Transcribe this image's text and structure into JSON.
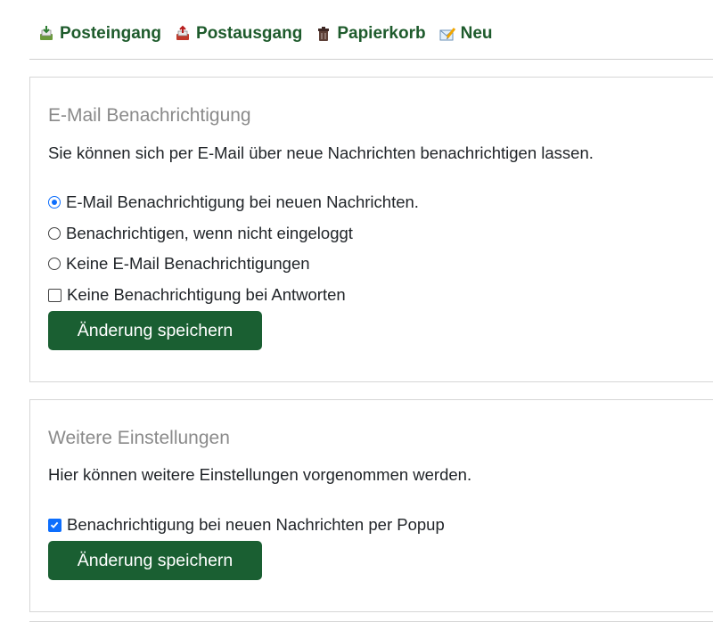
{
  "nav": {
    "items": [
      {
        "label": "Posteingang",
        "icon": "inbox-tray-icon"
      },
      {
        "label": "Postausgang",
        "icon": "outbox-tray-icon"
      },
      {
        "label": "Papierkorb",
        "icon": "trash-bin-icon"
      },
      {
        "label": "Neu",
        "icon": "compose-icon"
      }
    ]
  },
  "email_notification": {
    "title": "E-Mail Benachrichtigung",
    "description": "Sie können sich per E-Mail über neue Nachrichten benachrichtigen lassen.",
    "options": [
      {
        "label": "E-Mail Benachrichtigung bei neuen Nachrichten.",
        "type": "radio",
        "checked": true
      },
      {
        "label": "Benachrichtigen, wenn nicht eingeloggt",
        "type": "radio",
        "checked": false
      },
      {
        "label": "Keine E-Mail Benachrichtigungen",
        "type": "radio",
        "checked": false
      },
      {
        "label": "Keine Benachrichtigung bei Antworten",
        "type": "checkbox",
        "checked": false
      }
    ],
    "save_label": "Änderung speichern"
  },
  "more_settings": {
    "title": "Weitere Einstellungen",
    "description": "Hier können weitere Einstellungen vorgenommen werden.",
    "options": [
      {
        "label": "Benachrichtigung bei neuen Nachrichten per Popup",
        "type": "checkbox",
        "checked": true
      }
    ],
    "save_label": "Änderung speichern"
  },
  "colors": {
    "nav_link": "#1e5b2c",
    "button_bg": "#1a5f32",
    "control_accent": "#0d6efd",
    "title_gray": "#8a8a8a"
  }
}
